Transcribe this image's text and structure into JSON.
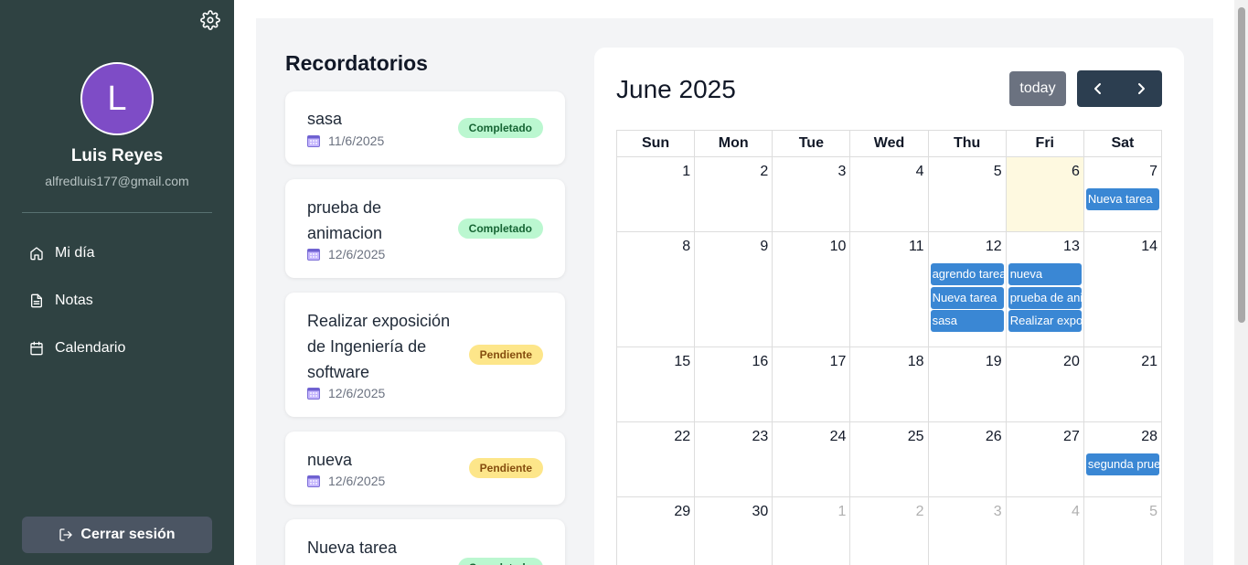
{
  "sidebar": {
    "avatar_initial": "L",
    "user_name": "Luis Reyes",
    "user_email": "alfredluis177@gmail.com",
    "nav": [
      {
        "label": "Mi día",
        "icon": "home-icon"
      },
      {
        "label": "Notas",
        "icon": "document-icon"
      },
      {
        "label": "Calendario",
        "icon": "calendar-icon"
      }
    ],
    "logout_label": "Cerrar sesión",
    "colors": {
      "background": "#2f4242",
      "avatar": "#7e4cc6",
      "logout": "#4b5563"
    }
  },
  "reminders": {
    "title": "Recordatorios",
    "items": [
      {
        "title": "sasa",
        "date": "11/6/2025",
        "status": "Completado"
      },
      {
        "title": "prueba de animacion",
        "date": "12/6/2025",
        "status": "Completado"
      },
      {
        "title": "Realizar exposición de Ingeniería de software",
        "date": "12/6/2025",
        "status": "Pendiente"
      },
      {
        "title": "nueva",
        "date": "12/6/2025",
        "status": "Pendiente"
      },
      {
        "title": "Nueva tarea",
        "date": "",
        "status": "Completado"
      }
    ]
  },
  "calendar": {
    "title": "June 2025",
    "today_label": "today",
    "weekdays": [
      "Sun",
      "Mon",
      "Tue",
      "Wed",
      "Thu",
      "Fri",
      "Sat"
    ],
    "weeks": [
      [
        {
          "n": "1"
        },
        {
          "n": "2"
        },
        {
          "n": "3"
        },
        {
          "n": "4"
        },
        {
          "n": "5"
        },
        {
          "n": "6",
          "today": true
        },
        {
          "n": "7",
          "events": [
            "Nueva tarea"
          ]
        }
      ],
      [
        {
          "n": "8"
        },
        {
          "n": "9"
        },
        {
          "n": "10"
        },
        {
          "n": "11"
        },
        {
          "n": "12",
          "events": [
            "agrendo tarea",
            "Nueva tarea",
            "sasa"
          ]
        },
        {
          "n": "13",
          "events": [
            "nueva",
            "prueba de animacion",
            "Realizar exposición de Ingeniería de software"
          ]
        },
        {
          "n": "14"
        }
      ],
      [
        {
          "n": "15"
        },
        {
          "n": "16"
        },
        {
          "n": "17"
        },
        {
          "n": "18"
        },
        {
          "n": "19"
        },
        {
          "n": "20"
        },
        {
          "n": "21"
        }
      ],
      [
        {
          "n": "22"
        },
        {
          "n": "23"
        },
        {
          "n": "24"
        },
        {
          "n": "25"
        },
        {
          "n": "26"
        },
        {
          "n": "27"
        },
        {
          "n": "28",
          "events": [
            "segunda prueba"
          ]
        }
      ],
      [
        {
          "n": "29"
        },
        {
          "n": "30"
        },
        {
          "n": "1",
          "other": true
        },
        {
          "n": "2",
          "other": true
        },
        {
          "n": "3",
          "other": true
        },
        {
          "n": "4",
          "other": true
        },
        {
          "n": "5",
          "other": true
        }
      ]
    ],
    "colors": {
      "event": "#3a87d4",
      "today_bg": "#fef9e0",
      "nav_buttons": "#2c3e50",
      "today_button": "#6b7280"
    }
  }
}
